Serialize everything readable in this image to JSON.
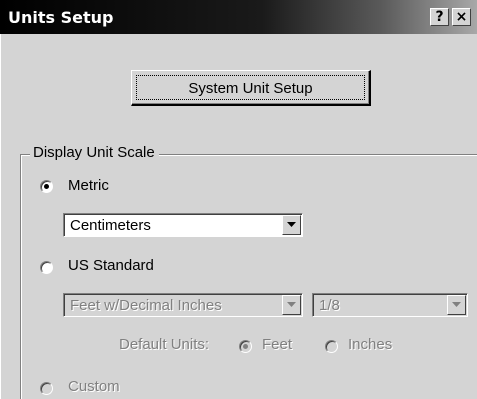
{
  "window": {
    "title": "Units Setup",
    "help_label": "?",
    "close_label": "×"
  },
  "system_unit_button": {
    "label": "System Unit Setup"
  },
  "display_unit_scale": {
    "group_title": "Display Unit Scale",
    "metric": {
      "label": "Metric",
      "selected": true,
      "dropdown_value": "Centimeters"
    },
    "us_standard": {
      "label": "US Standard",
      "selected": false,
      "format_value": "Feet w/Decimal Inches",
      "fraction_value": "1/8",
      "default_units_label": "Default Units:",
      "feet_label": "Feet",
      "inches_label": "Inches"
    },
    "custom": {
      "label": "Custom"
    }
  },
  "icons": {
    "dropdown": "chevron-down-icon",
    "radio": "radio-button"
  }
}
